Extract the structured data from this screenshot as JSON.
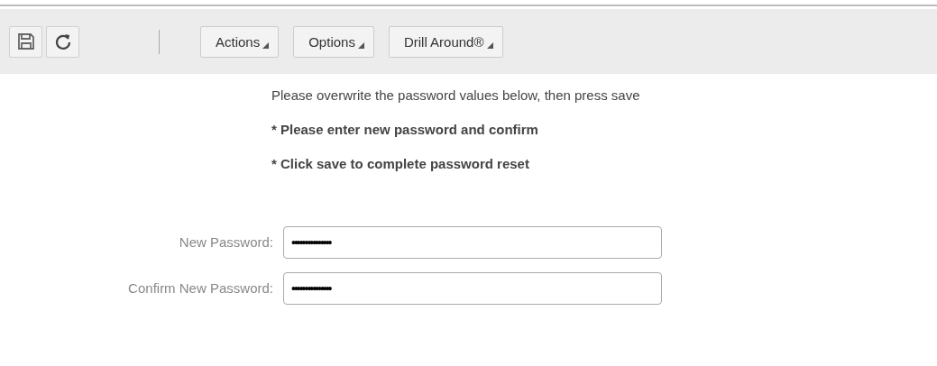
{
  "toolbar": {
    "menus": [
      {
        "label": "Actions"
      },
      {
        "label": "Options"
      },
      {
        "label": "Drill Around®"
      }
    ]
  },
  "instructions": {
    "intro": "Please overwrite the password values below, then press save",
    "steps": [
      "* Please enter new password and confirm",
      "* Click save to complete password reset"
    ]
  },
  "fields": [
    {
      "label": "New Password:",
      "value": "•••••••••••••••"
    },
    {
      "label": "Confirm New Password:",
      "value": "•••••••••••••••"
    }
  ]
}
